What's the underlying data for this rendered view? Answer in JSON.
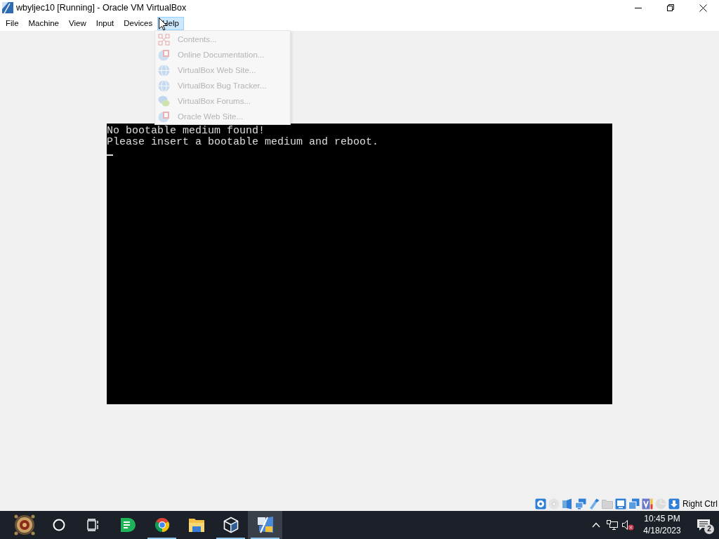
{
  "window": {
    "title": "wbyljec10 [Running] - Oracle VM VirtualBox"
  },
  "menu_bar": [
    {
      "label": "File",
      "selected": false
    },
    {
      "label": "Machine",
      "selected": false
    },
    {
      "label": "View",
      "selected": false
    },
    {
      "label": "Input",
      "selected": false
    },
    {
      "label": "Devices",
      "selected": false
    },
    {
      "label": "Help",
      "selected": true
    }
  ],
  "help_menu": [
    {
      "label": "Contents...",
      "kind": "contents"
    },
    {
      "label": "Online Documentation...",
      "kind": "document"
    },
    {
      "label": "VirtualBox Web Site...",
      "kind": "globe"
    },
    {
      "label": "VirtualBox Bug Tracker...",
      "kind": "globe"
    },
    {
      "label": "VirtualBox Forums...",
      "kind": "forum"
    },
    {
      "label": "Oracle Web Site...",
      "kind": "document"
    }
  ],
  "console": {
    "lines": [
      "No bootable medium found!",
      "Please insert a bootable medium and reboot."
    ]
  },
  "status_bar": {
    "indicators": [
      {
        "kind": "hard_disk",
        "enabled": true
      },
      {
        "kind": "optical_drive",
        "enabled": false
      },
      {
        "kind": "audio",
        "enabled": true
      },
      {
        "kind": "network",
        "enabled": true
      },
      {
        "kind": "usb",
        "enabled": true
      },
      {
        "kind": "shared_folders",
        "enabled": false
      },
      {
        "kind": "display",
        "enabled": true
      },
      {
        "kind": "recording",
        "enabled": true
      },
      {
        "kind": "cpu",
        "enabled": true
      },
      {
        "kind": "mouse",
        "enabled": false
      },
      {
        "kind": "keyboard",
        "enabled": true
      }
    ],
    "host_key": "Right Ctrl"
  },
  "taskbar": {
    "apps": [
      {
        "kind": "notes",
        "running": false,
        "selected": false
      },
      {
        "kind": "browser",
        "running": true,
        "selected": false
      },
      {
        "kind": "files",
        "running": false,
        "selected": false
      },
      {
        "kind": "virtualbox",
        "running": true,
        "selected": false
      },
      {
        "kind": "vm",
        "running": true,
        "selected": true
      }
    ],
    "clock": {
      "time": "10:45 PM",
      "date": "4/18/2023"
    },
    "notifications": "2"
  }
}
